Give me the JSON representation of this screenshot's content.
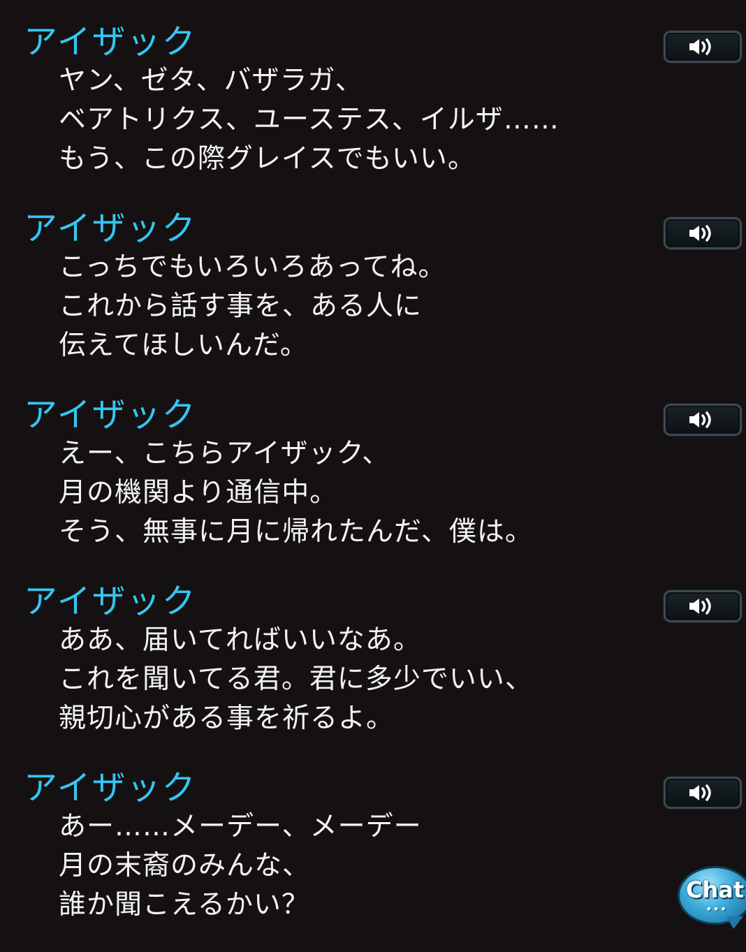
{
  "log": {
    "entries": [
      {
        "speaker": "アイザック",
        "lines": [
          "ヤン、ゼタ、バザラガ、",
          "ベアトリクス、ユーステス、イルザ……",
          "もう、この際グレイスでもいい。"
        ],
        "voice_icon": "speaker-volume-icon"
      },
      {
        "speaker": "アイザック",
        "lines": [
          "こっちでもいろいろあってね。",
          "これから話す事を、ある人に",
          "伝えてほしいんだ。"
        ],
        "voice_icon": "speaker-volume-icon"
      },
      {
        "speaker": "アイザック",
        "lines": [
          "えー、こちらアイザック、",
          "月の機関より通信中。",
          "そう、無事に月に帰れたんだ、僕は。"
        ],
        "voice_icon": "speaker-volume-icon"
      },
      {
        "speaker": "アイザック",
        "lines": [
          "ああ、届いてればいいなあ。",
          "これを聞いてる君。君に多少でいい、",
          "親切心がある事を祈るよ。"
        ],
        "voice_icon": "speaker-volume-icon"
      },
      {
        "speaker": "アイザック",
        "lines": [
          "あー……メーデー、メーデー",
          "月の末裔のみんな、",
          "誰か聞こえるかい？"
        ],
        "voice_icon": "speaker-volume-icon"
      }
    ]
  },
  "chat_button": {
    "label": "Chat",
    "dots": "•••"
  },
  "colors": {
    "background": "#151112",
    "speaker_name": "#35c6f2",
    "dialogue_text": "#f3f3f3",
    "voice_button_border": "#3d4a52"
  }
}
